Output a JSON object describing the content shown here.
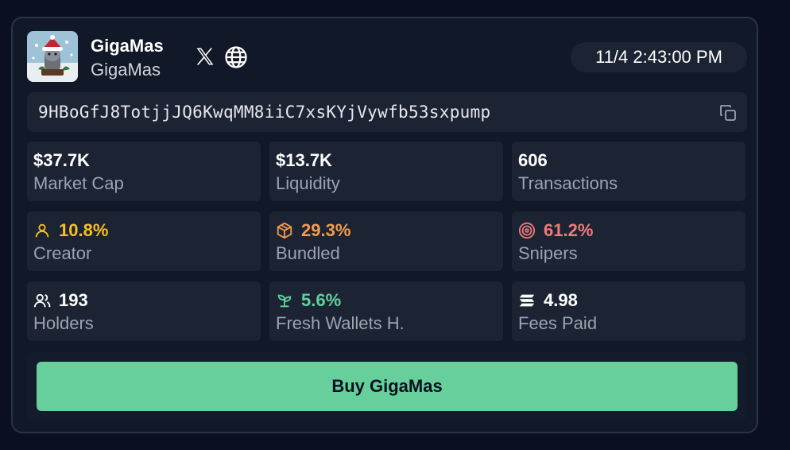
{
  "token": {
    "name": "GigaMas",
    "symbol": "GigaMas",
    "address": "9HBoGfJ8TotjjJQ6KwqMM8iiC7xsKYjVywfb53sxpump",
    "timestamp": "11/4 2:43:00 PM"
  },
  "links": {
    "x_icon": "x-logo-icon",
    "web_icon": "globe-icon"
  },
  "stats": [
    {
      "value": "$37.7K",
      "label": "Market Cap",
      "icon": null,
      "color": "#ffffff"
    },
    {
      "value": "$13.7K",
      "label": "Liquidity",
      "icon": null,
      "color": "#ffffff"
    },
    {
      "value": "606",
      "label": "Transactions",
      "icon": null,
      "color": "#ffffff"
    },
    {
      "value": "10.8%",
      "label": "Creator",
      "icon": "user-icon",
      "color": "#fbbf24"
    },
    {
      "value": "29.3%",
      "label": "Bundled",
      "icon": "box-icon",
      "color": "#f59a4c"
    },
    {
      "value": "61.2%",
      "label": "Snipers",
      "icon": "target-icon",
      "color": "#f07a78"
    },
    {
      "value": "193",
      "label": "Holders",
      "icon": "users-icon",
      "color": "#ffffff"
    },
    {
      "value": "5.6%",
      "label": "Fresh Wallets H.",
      "icon": "sprout-icon",
      "color": "#5ed39a"
    },
    {
      "value": "4.98",
      "label": "Fees Paid",
      "icon": "solana-icon",
      "color": "#ffffff"
    }
  ],
  "buy": {
    "label": "Buy GigaMas",
    "color": "#66cf9b"
  }
}
